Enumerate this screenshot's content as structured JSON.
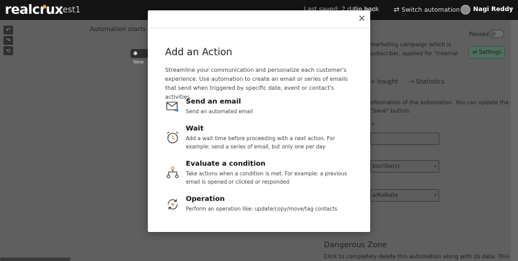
{
  "header": {
    "logo": "realcrux",
    "project": "test1",
    "saved": "Last saved: 2 days ago",
    "go_back": "Go back",
    "switch": "Switch automation",
    "user": "Nagi Reddy"
  },
  "canvas": {
    "starts_text": "Automation starts wh",
    "new_node": "New"
  },
  "panel": {
    "paused_label": "Paused",
    "desc_line1": "marketing campaign which is",
    "desc_line2": "subscriber, applied for \"internal",
    "settings_label": "Settings",
    "tab_insight": "Insight",
    "tab_statistics": "Statistics",
    "info_line1": "nformation of the automation. You can update the",
    "info_line2": "\"Save\" button.",
    "required_star": "*",
    "list_value": "bscribers)",
    "timezone_value": "a/Kolkata",
    "danger_title": "Dangerous Zone",
    "danger_desc": "Click to completely delete this automation along with its data. This"
  },
  "modal": {
    "title": "Add an Action",
    "intro": "Streamline your communication and personalize each customer's experience. Use automation to create an email or series of emails that send when triggered by specific date, event or contact's activities.",
    "options": [
      {
        "icon": "email-icon",
        "title": "Send an email",
        "desc": "Send an automated email"
      },
      {
        "icon": "alarm-clock-icon",
        "title": "Wait",
        "desc": "Add a wait time before proceeding with a next action. For example: send a series of email, but only one per day"
      },
      {
        "icon": "flow-branch-icon",
        "title": "Evaluate a condition",
        "desc": "Take actions when a condition is met. For example: a previous email is opened or clicked or responded"
      },
      {
        "icon": "refresh-cycle-icon",
        "title": "Operation",
        "desc": "Perform an operation like: update/copy/move/tag contacts"
      }
    ]
  },
  "colors": {
    "overlay": "#5f5f5f",
    "topbar": "#141414",
    "accent_orange": "#f5a623",
    "icon_blue": "#2f80c4",
    "icon_orange": "#e07a2e"
  }
}
